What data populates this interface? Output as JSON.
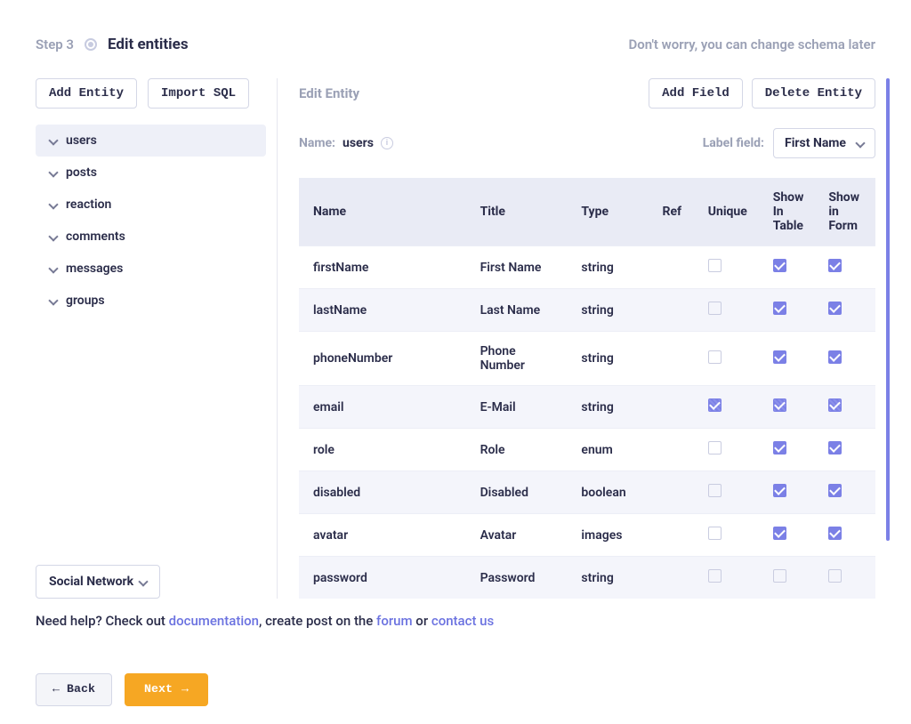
{
  "header": {
    "step_label": "Step 3",
    "title": "Edit entities",
    "hint": "Don't worry, you can change schema later"
  },
  "left": {
    "add_entity_label": "Add Entity",
    "import_sql_label": "Import SQL",
    "entities": [
      {
        "name": "users",
        "active": true
      },
      {
        "name": "posts",
        "active": false
      },
      {
        "name": "reaction",
        "active": false
      },
      {
        "name": "comments",
        "active": false
      },
      {
        "name": "messages",
        "active": false
      },
      {
        "name": "groups",
        "active": false
      }
    ],
    "template_label": "Social Network"
  },
  "right": {
    "edit_title": "Edit Entity",
    "add_field_label": "Add Field",
    "delete_entity_label": "Delete Entity",
    "name_label": "Name:",
    "name_value": "users",
    "label_field_label": "Label field:",
    "label_field_value": "First Name",
    "columns": {
      "name": "Name",
      "title": "Title",
      "type": "Type",
      "ref": "Ref",
      "unique": "Unique",
      "show_in_table": "Show In Table",
      "show_in_form": "Show in Form"
    },
    "fields": [
      {
        "name": "firstName",
        "title": "First Name",
        "type": "string",
        "ref": "",
        "unique": false,
        "unique_striped": false,
        "show_table": true,
        "show_form": true,
        "alt": false
      },
      {
        "name": "lastName",
        "title": "Last Name",
        "type": "string",
        "ref": "",
        "unique": false,
        "unique_striped": false,
        "show_table": true,
        "show_form": true,
        "alt": true
      },
      {
        "name": "phoneNumber",
        "title": "Phone Number",
        "type": "string",
        "ref": "",
        "unique": false,
        "unique_striped": false,
        "show_table": true,
        "show_form": true,
        "alt": false
      },
      {
        "name": "email",
        "title": "E-Mail",
        "type": "string",
        "ref": "",
        "unique": true,
        "unique_striped": true,
        "show_table": true,
        "show_form": true,
        "alt": true,
        "striped_all": true
      },
      {
        "name": "role",
        "title": "Role",
        "type": "enum",
        "ref": "",
        "unique": false,
        "unique_striped": false,
        "show_table": true,
        "show_form": true,
        "alt": false
      },
      {
        "name": "disabled",
        "title": "Disabled",
        "type": "boolean",
        "ref": "",
        "unique": false,
        "unique_striped": false,
        "show_table": true,
        "show_form": true,
        "alt": true
      },
      {
        "name": "avatar",
        "title": "Avatar",
        "type": "images",
        "ref": "",
        "unique": false,
        "unique_striped": false,
        "show_table": true,
        "show_form": true,
        "alt": false
      },
      {
        "name": "password",
        "title": "Password",
        "type": "string",
        "ref": "",
        "unique": false,
        "unique_striped": false,
        "show_table": false,
        "show_form": false,
        "alt": true
      }
    ]
  },
  "help": {
    "prefix": "Need help? Check out ",
    "doc": "documentation",
    "mid1": ", create post on the ",
    "forum": "forum",
    "mid2": " or ",
    "contact": "contact us"
  },
  "footer": {
    "back": "Back",
    "next": "Next"
  }
}
